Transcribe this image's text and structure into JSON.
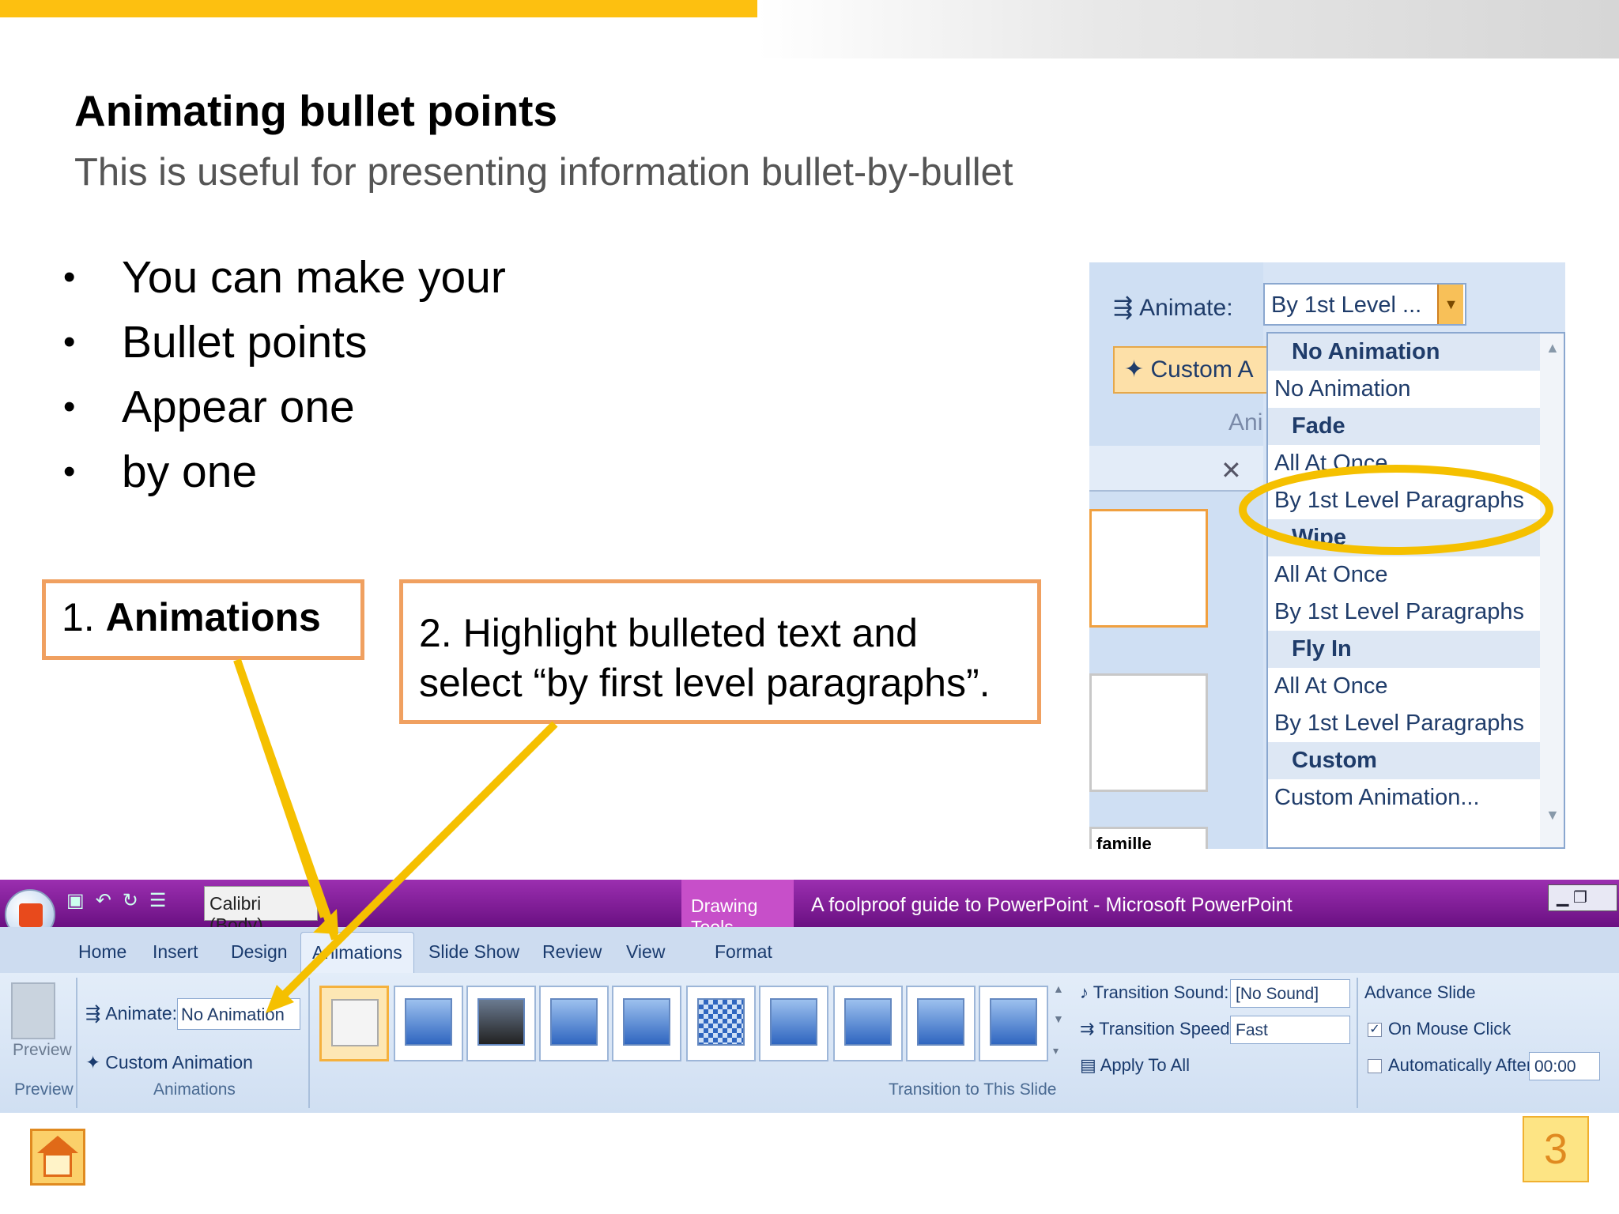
{
  "slide": {
    "title": "Animating bullet points",
    "subtitle": "This is useful for presenting information bullet-by-bullet",
    "bullets": [
      {
        "marker": "•",
        "text": "You can make your"
      },
      {
        "marker": "•",
        "text": "Bullet points"
      },
      {
        "marker": "•",
        "text": "Appear one"
      },
      {
        "marker": "•",
        "text": "by one"
      }
    ],
    "callout1": {
      "prefix": "1.",
      "bold": "Animations"
    },
    "callout2": {
      "line1": "2. Highlight bulleted text and",
      "line2": "select “by first level paragraphs”."
    },
    "page_number": "3",
    "accent_color": "#fdc010",
    "arrow_color": "#f5c000",
    "callout_border": "#f0a060"
  },
  "inset": {
    "animate_label": "Animate:",
    "animate_value": "By 1st Level ...",
    "custom_label": "Custom A",
    "ani_label": "Ani",
    "menu": [
      {
        "text": "No Animation",
        "head": true
      },
      {
        "text": "No Animation",
        "head": false
      },
      {
        "text": "Fade",
        "head": true
      },
      {
        "text": "All At Once",
        "head": false
      },
      {
        "text": "By 1st Level Paragraphs",
        "head": false,
        "highlight": true
      },
      {
        "text": "Wipe",
        "head": true
      },
      {
        "text": "All At Once",
        "head": false
      },
      {
        "text": "By 1st Level Paragraphs",
        "head": false
      },
      {
        "text": "Fly In",
        "head": true
      },
      {
        "text": "All At Once",
        "head": false
      },
      {
        "text": "By 1st Level Paragraphs",
        "head": false
      },
      {
        "text": "Custom",
        "head": true
      },
      {
        "text": "Custom Animation...",
        "head": false
      }
    ],
    "thumb_caption": "famille"
  },
  "ribbon": {
    "font_name": "Calibri (Body)",
    "drawing_tools": "Drawing Tools",
    "app_title": "A foolproof guide to PowerPoint - Microsoft PowerPoint",
    "tabs": [
      "Home",
      "Insert",
      "Design",
      "Animations",
      "Slide Show",
      "Review",
      "View",
      "Format"
    ],
    "preview": {
      "button": "Preview",
      "group": "Preview"
    },
    "animations": {
      "animate_label": "Animate:",
      "animate_value": "No Animation",
      "custom_animation": "Custom Animation",
      "group": "Animations"
    },
    "transition": {
      "group": "Transition to This Slide",
      "sound_label": "Transition Sound:",
      "sound_value": "[No Sound]",
      "speed_label": "Transition Speed:",
      "speed_value": "Fast",
      "apply_all": "Apply To All"
    },
    "advance": {
      "title": "Advance Slide",
      "on_click": "On Mouse Click",
      "on_click_checked": true,
      "auto_after": "Automatically After:",
      "auto_time": "00:00"
    }
  }
}
